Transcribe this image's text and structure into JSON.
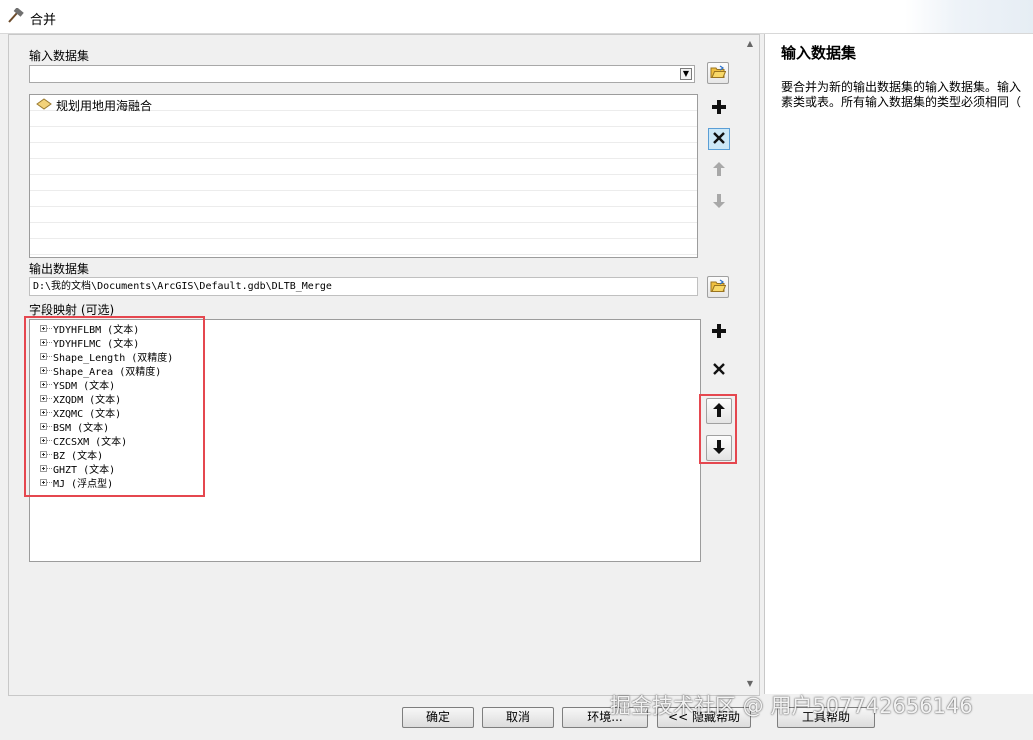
{
  "window": {
    "title": "合并"
  },
  "form": {
    "input_label": "输入数据集",
    "input_combo_value": "",
    "input_list": [
      {
        "label": "规划用地用海融合",
        "icon": "polygon-layer-icon"
      }
    ],
    "output_label": "输出数据集",
    "output_value": "D:\\我的文档\\Documents\\ArcGIS\\Default.gdb\\DLTB_Merge",
    "field_map_label": "字段映射 (可选)",
    "fields": [
      "YDYHFLBM (文本)",
      "YDYHFLMC (文本)",
      "Shape_Length (双精度)",
      "Shape_Area (双精度)",
      "YSDM (文本)",
      "XZQDM (文本)",
      "XZQMC (文本)",
      "BSM (文本)",
      "CZCSXM (文本)",
      "BZ (文本)",
      "GHZT (文本)",
      "MJ (浮点型)"
    ]
  },
  "help": {
    "title": "输入数据集",
    "body_line1": "要合并为新的输出数据集的输入数据集。输入",
    "body_line2": "素类或表。所有输入数据集的类型必须相同（"
  },
  "buttons": {
    "ok": "确定",
    "cancel": "取消",
    "env": "环境...",
    "hide_help": "<< 隐藏帮助",
    "tool_help": "工具帮助"
  },
  "watermark": "掘金技术社区 @ 用户507742656146",
  "colors": {
    "highlight": "#e5474f",
    "selected_button": "#cde8f7"
  }
}
